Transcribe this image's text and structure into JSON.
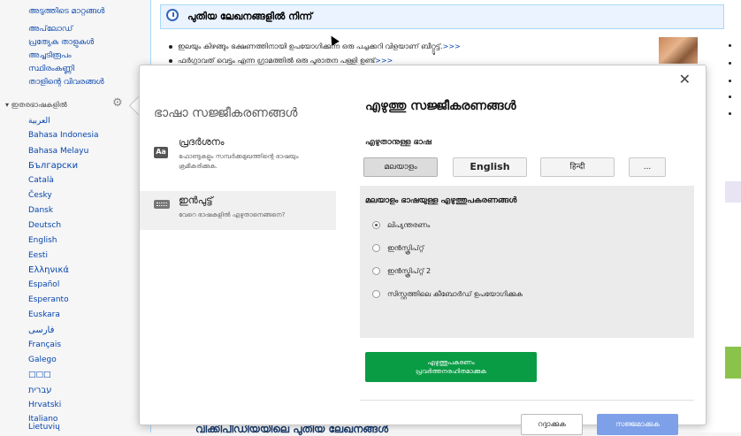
{
  "sidebar": {
    "links": [
      "അടുത്തിടെ മാറ്റങ്ങൾ",
      "അപ്‌ലോഡ്",
      "പ്രത്യേക താളുകൾ",
      "അച്ചടിരൂപം",
      "സ്ഥിരംകണ്ണി",
      "താളിന്റെ വിവരങ്ങൾ"
    ],
    "languages_heading": "ഇതരഭാഷകളിൽ",
    "languages": [
      "العربية",
      "Bahasa Indonesia",
      "Bahasa Melayu",
      "Български",
      "Català",
      "Česky",
      "Dansk",
      "Deutsch",
      "English",
      "Eesti",
      "Ελληνικά",
      "Español",
      "Esperanto",
      "Euskara",
      "فارسی",
      "Français",
      "Galego",
      "□□□",
      "עברית",
      "Hrvatski",
      "Italiano",
      "Lietuvių"
    ]
  },
  "content": {
    "featured_title": "പുതിയ ലേഖനങ്ങളിൽ നിന്ന്",
    "news": [
      {
        "text": "ഇലയും കിഴങ്ങും ഭക്ഷണത്തിനായി ഉപയോഗിക്കുന്ന ഒരു പച്ചക്കറി വിളയാണ് ബീറ്റ്റൂട്ട്.",
        "more": ">>>"
      },
      {
        "text": "ഫർഗ്ഗാവത് വെട്ടം എന്ന ഗ്രാമത്തിൽ ഒരു പുരാതന പള്ളി ഉണ്ട്",
        "more": ">>>"
      }
    ],
    "bottom_heading": "വിക്കിപീഡിയയിലെ പുതിയ ലേഖനങ്ങൾ"
  },
  "dialog": {
    "left_title": "ഭാഷാ സജ്ജീകരണങ്ങൾ",
    "menu": [
      {
        "title": "പ്രദർശനം",
        "desc": "ഫോണ്ടുകളും സമ്പർക്കമുഖത്തിന്റെ ഭാഷയും ക്രമീകരിക്കുക."
      },
      {
        "title": "ഇൻപുട്ട്",
        "desc": "വേറെ ഭാഷകളിൽ എഴുതാനെങ്ങനെ?"
      }
    ],
    "close_label": "✕",
    "settings_title": "എഴുത്തു സജ്ജീകരണങ്ങൾ",
    "input_language_label": "എഴുതാനുള്ള ഭാഷ",
    "language_buttons": [
      "മലയാളം",
      "English",
      "हिन्दी",
      "..."
    ],
    "methods_title": "മലയാളം ഭാഷയുള്ള എഴുത്തുപകരണങ്ങൾ",
    "methods": [
      "ലിപ്യന്തരണം",
      "ഇൻസ്ക്രിപ്റ്റ്",
      "ഇൻസ്ക്രിപ്റ്റ് 2",
      "സിസ്റ്റത്തിലെ കീബോർഡ് ഉപയോഗിക്കുക"
    ],
    "selected_method": 0,
    "disable_button": {
      "line1": "എഴുത്തുപകരണം",
      "line2": "പ്രവർത്തനരഹിതമാക്കുക"
    },
    "cancel_label": "റദ്ദാക്കുക",
    "apply_label": "സജ്ജമാക്കുക"
  },
  "colors": {
    "accent_green": "#0a9c45",
    "apply_blue": "#7da0e8",
    "link_blue": "#0645ad"
  }
}
